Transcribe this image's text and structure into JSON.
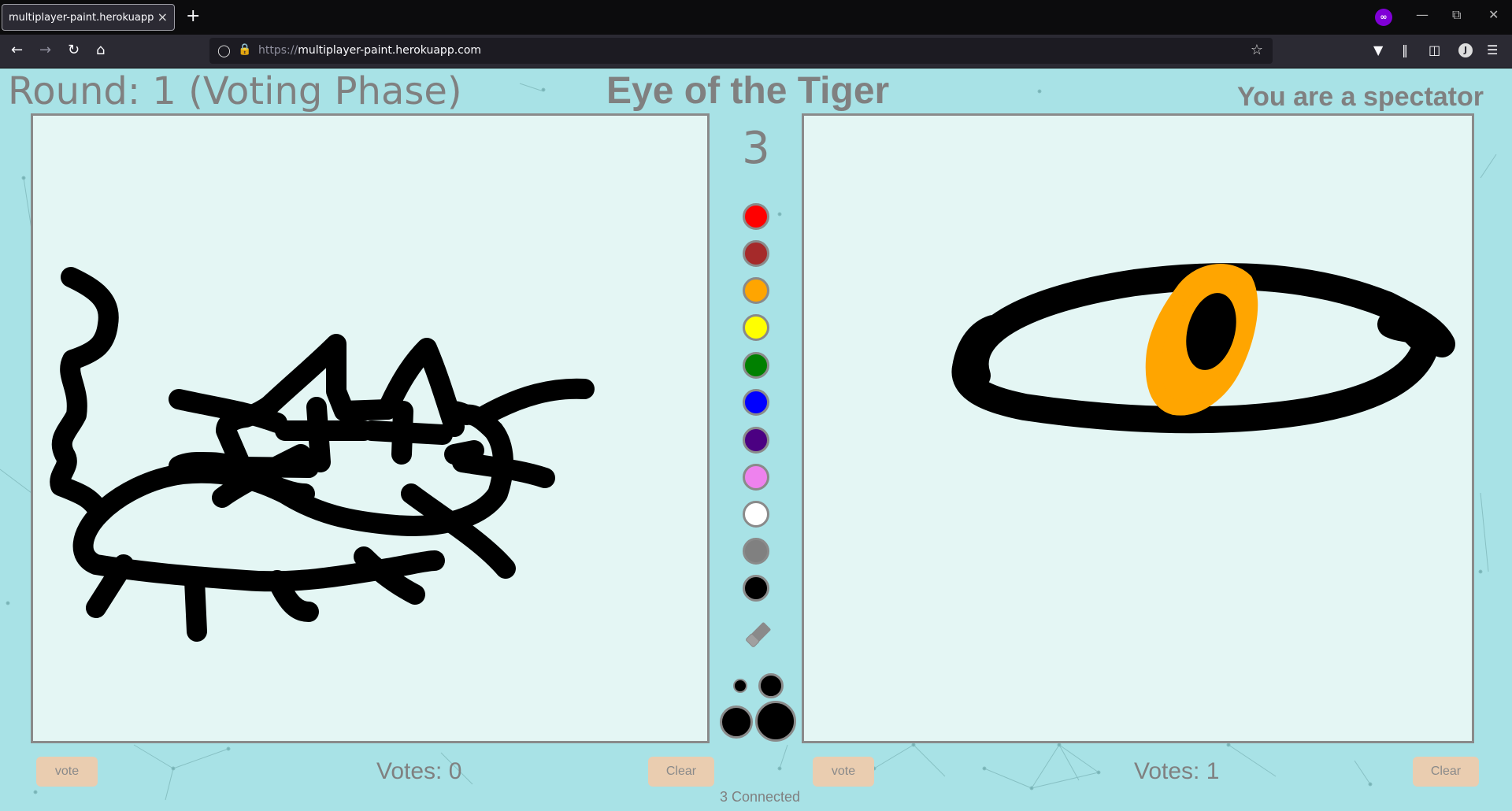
{
  "browser": {
    "tab_title": "multiplayer-paint.herokuapp.com/",
    "tab_close": "×",
    "new_tab": "+",
    "url_scheme": "https://",
    "url_host": "multiplayer-paint.herokuapp.com",
    "avatar_letter": "J",
    "private_badge": "∞"
  },
  "game": {
    "round_text": "Round: 1 (Voting Phase)",
    "prompt": "Eye of the Tiger",
    "role_text": "You are a spectator",
    "timer": "3",
    "connected_text": "3 Connected"
  },
  "palette": {
    "colors": [
      "#ff0000",
      "#a52a2a",
      "#ffa500",
      "#ffff00",
      "#008000",
      "#0000ff",
      "#4b0082",
      "#ee82ee",
      "#ffffff",
      "#808080",
      "#000000"
    ],
    "eraser_icon": "eraser-icon",
    "brush_sizes": [
      "small",
      "medium",
      "large",
      "x-large"
    ]
  },
  "left_panel": {
    "vote_label": "vote",
    "votes_text": "Votes: 0",
    "clear_label": "Clear"
  },
  "right_panel": {
    "vote_label": "vote",
    "votes_text": "Votes: 1",
    "clear_label": "Clear"
  }
}
